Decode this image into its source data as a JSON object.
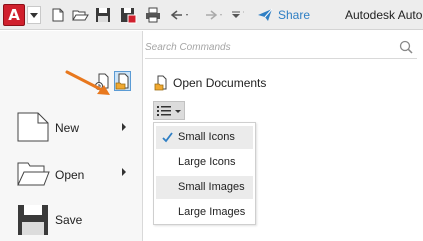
{
  "quick_access_toolbar": {
    "app_button_letter": "A",
    "buttons": [
      "new-icon",
      "open-icon",
      "save-icon",
      "save-as-icon",
      "plot-icon",
      "undo-icon",
      "redo-icon",
      "customize-icon"
    ],
    "share_label": "Share",
    "app_title": "Autodesk Auto"
  },
  "menu": {
    "search_placeholder": "Search Commands",
    "items": [
      {
        "label": "New",
        "has_submenu": true
      },
      {
        "label": "Open",
        "has_submenu": true
      },
      {
        "label": "Save",
        "has_submenu": false
      }
    ],
    "panel_toggles": [
      "recent-documents-icon",
      "open-documents-icon"
    ],
    "active_toggle": "open-documents-icon"
  },
  "open_documents": {
    "heading": "Open Documents",
    "view_options": [
      {
        "label": "Small Icons",
        "checked": true
      },
      {
        "label": "Large Icons",
        "checked": false
      },
      {
        "label": "Small Images",
        "checked": false
      },
      {
        "label": "Large Images",
        "checked": false
      }
    ]
  },
  "colors": {
    "app_button": "#d0202d",
    "share_text": "#2f7fc4",
    "callout_arrow": "#e8781e",
    "active_toggle": "#cde4f7",
    "check_mark": "#2f7fc4"
  }
}
